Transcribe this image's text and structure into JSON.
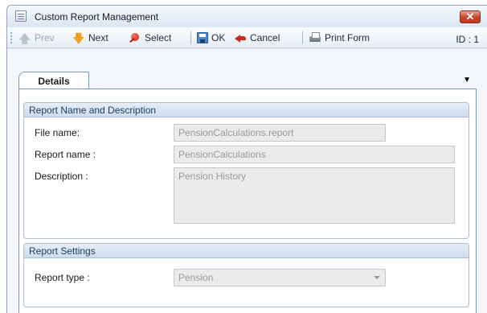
{
  "window": {
    "title": "Custom Report Management",
    "close_label": "✕"
  },
  "toolbar": {
    "prev_label": "Prev",
    "next_label": "Next",
    "select_label": "Select",
    "ok_label": "OK",
    "cancel_label": "Cancel",
    "print_label": "Print Form",
    "id_label": "ID : 1"
  },
  "tabs": [
    {
      "label": "Details",
      "active": true
    }
  ],
  "groups": {
    "name_desc": {
      "title": "Report Name and Description",
      "file_name_label": "File name:",
      "file_name_value": "PensionCalculations.report",
      "report_name_label": "Report name :",
      "report_name_value": "PensionCalculations",
      "description_label": "Description :",
      "description_value": "Pension History"
    },
    "settings": {
      "title": "Report Settings",
      "report_type_label": "Report type :",
      "report_type_value": "Pension"
    }
  },
  "colors": {
    "accent": "#7f97b7",
    "group_header": "#cfdced",
    "close_button": "#c7422b",
    "field_background": "#ebebeb"
  }
}
